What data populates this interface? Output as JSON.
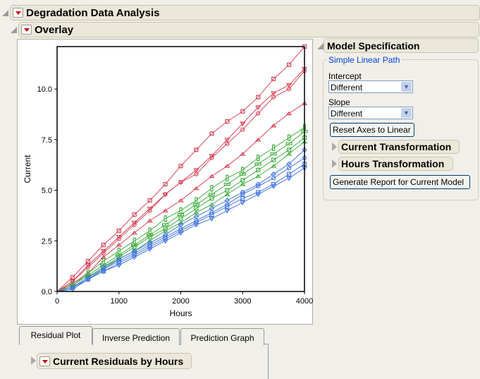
{
  "report": {
    "title": "Degradation Data Analysis"
  },
  "overlay": {
    "title": "Overlay"
  },
  "model_spec": {
    "title": "Model Specification",
    "group_label": "Simple Linear Path",
    "intercept_label": "Intercept",
    "intercept_value": "Different",
    "slope_label": "Slope",
    "slope_value": "Different",
    "reset_button": "Reset Axes to Linear",
    "current_transformation": "Current Transformation",
    "hours_transformation": "Hours Transformation",
    "generate_button": "Generate Report for Current Model"
  },
  "tabs": [
    {
      "label": "Residual Plot",
      "active": true
    },
    {
      "label": "Inverse Prediction",
      "active": false
    },
    {
      "label": "Prediction Graph",
      "active": false
    }
  ],
  "residuals": {
    "title": "Current Residuals by Hours"
  },
  "colors": {
    "red": "#d8485c",
    "green": "#45b045",
    "blue": "#4678e0"
  },
  "chart_data": {
    "type": "line",
    "xlabel": "Hours",
    "ylabel": "Current",
    "xlim": [
      0,
      4000
    ],
    "ylim": [
      0,
      12.1
    ],
    "xticks": [
      "0",
      "1000",
      "2000",
      "3000",
      "4000"
    ],
    "xtick_values": [
      0,
      1000,
      2000,
      3000,
      4000
    ],
    "yticks": [
      "0.0",
      "2.5",
      "5.0",
      "7.5",
      "10.0"
    ],
    "ytick_values": [
      0,
      2.5,
      5,
      7.5,
      10
    ],
    "x": [
      0,
      250,
      500,
      750,
      1000,
      1250,
      1500,
      1750,
      2000,
      2250,
      2500,
      2750,
      3000,
      3250,
      3500,
      3750,
      4000
    ],
    "series": [
      {
        "name": "red-1",
        "color": "red",
        "marker": "square",
        "values": [
          0,
          0.7,
          1.5,
          2.3,
          3.0,
          3.8,
          4.5,
          5.3,
          6.2,
          7.0,
          7.8,
          8.4,
          8.9,
          9.6,
          10.5,
          11.2,
          12.1
        ]
      },
      {
        "name": "red-2",
        "color": "red",
        "marker": "tri-down",
        "values": [
          0,
          0.5,
          1.3,
          2.0,
          2.7,
          3.4,
          4.1,
          4.8,
          5.4,
          6.0,
          6.7,
          7.5,
          8.3,
          9.1,
          9.8,
          10.2,
          11.0
        ]
      },
      {
        "name": "red-3",
        "color": "red",
        "marker": "circle",
        "values": [
          0,
          0.5,
          1.2,
          1.9,
          2.6,
          3.3,
          4.0,
          4.8,
          5.4,
          5.8,
          6.6,
          7.3,
          8.0,
          8.8,
          9.6,
          10.0,
          10.9
        ]
      },
      {
        "name": "red-4",
        "color": "red",
        "marker": "tri-up",
        "values": [
          0,
          0.4,
          0.9,
          1.7,
          2.3,
          2.9,
          3.5,
          4.0,
          4.5,
          5.1,
          5.7,
          6.2,
          6.8,
          7.5,
          8.2,
          8.8,
          9.3
        ]
      },
      {
        "name": "green-1",
        "color": "green",
        "marker": "tall-rect",
        "values": [
          0,
          0.3,
          0.9,
          1.5,
          2.0,
          2.5,
          3.0,
          3.6,
          4.0,
          4.5,
          5.1,
          5.6,
          6.0,
          6.6,
          7.1,
          7.6,
          8.1
        ]
      },
      {
        "name": "green-2",
        "color": "green",
        "marker": "wide-rect",
        "values": [
          0,
          0.3,
          0.8,
          1.3,
          1.8,
          2.3,
          2.8,
          3.3,
          3.8,
          4.3,
          4.8,
          5.3,
          5.8,
          6.3,
          6.8,
          7.3,
          7.9
        ]
      },
      {
        "name": "green-3",
        "color": "green",
        "marker": "square",
        "values": [
          0,
          0.2,
          0.7,
          1.2,
          1.7,
          2.2,
          2.7,
          3.1,
          3.6,
          4.1,
          4.6,
          5.0,
          5.5,
          6.0,
          6.5,
          7.0,
          7.6
        ]
      },
      {
        "name": "green-4",
        "color": "green",
        "marker": "tri-up",
        "values": [
          0,
          0.2,
          0.7,
          1.1,
          1.6,
          2.0,
          2.5,
          3.0,
          3.4,
          3.9,
          4.3,
          4.8,
          5.3,
          5.7,
          6.2,
          6.8,
          7.4
        ]
      },
      {
        "name": "blue-1",
        "color": "blue",
        "marker": "diamond",
        "values": [
          0,
          0.2,
          0.7,
          1.2,
          1.6,
          2.0,
          2.4,
          2.8,
          3.3,
          3.7,
          4.1,
          4.5,
          4.9,
          5.3,
          5.8,
          6.3,
          7.0
        ]
      },
      {
        "name": "blue-2",
        "color": "blue",
        "marker": "circle",
        "values": [
          0,
          0.2,
          0.6,
          1.1,
          1.5,
          1.9,
          2.3,
          2.7,
          3.1,
          3.5,
          3.9,
          4.3,
          4.8,
          5.2,
          5.6,
          6.1,
          6.6
        ]
      },
      {
        "name": "blue-3",
        "color": "blue",
        "marker": "square",
        "values": [
          0,
          0.2,
          0.6,
          1.0,
          1.4,
          1.8,
          2.2,
          2.6,
          3.0,
          3.4,
          3.8,
          4.2,
          4.6,
          4.9,
          5.3,
          5.8,
          6.3
        ]
      },
      {
        "name": "blue-4",
        "color": "blue",
        "marker": "tri-down",
        "values": [
          0,
          0.1,
          0.6,
          1.0,
          1.3,
          1.7,
          2.1,
          2.5,
          2.9,
          3.3,
          3.6,
          4.0,
          4.4,
          4.8,
          5.2,
          5.6,
          6.1
        ]
      }
    ]
  }
}
